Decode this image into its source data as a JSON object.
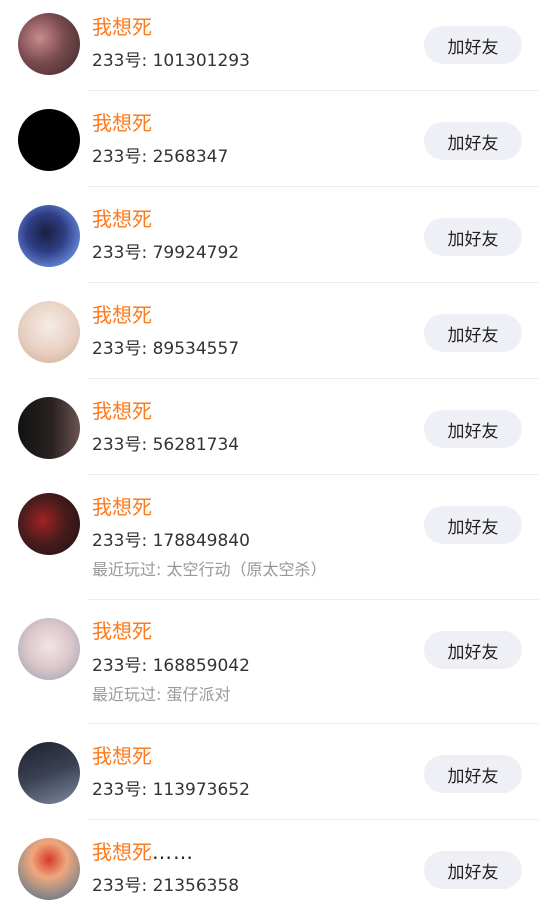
{
  "contacts": [
    {
      "name": "我想死",
      "id_prefix": "233号: ",
      "id": "101301293",
      "recent": "",
      "button": "加好友",
      "avatar_colors": [
        "#5a3a3f",
        "#c98b8b"
      ]
    },
    {
      "name": "我想死",
      "id_prefix": "233号: ",
      "id": "2568347",
      "recent": "",
      "button": "加好友",
      "avatar_colors": [
        "#000000",
        "#000000"
      ]
    },
    {
      "name": "我想死",
      "id_prefix": "233号: ",
      "id": "79924792",
      "recent": "",
      "button": "加好友",
      "avatar_colors": [
        "#2f3e86",
        "#6d8fe0"
      ]
    },
    {
      "name": "我想死",
      "id_prefix": "233号: ",
      "id": "89534557",
      "recent": "",
      "button": "加好友",
      "avatar_colors": [
        "#f3e6df",
        "#d9b9a5"
      ]
    },
    {
      "name": "我想死",
      "id_prefix": "233号: ",
      "id": "56281734",
      "recent": "",
      "button": "加好友",
      "avatar_colors": [
        "#1b1b1b",
        "#6a5450"
      ]
    },
    {
      "name": "我想死",
      "id_prefix": "233号: ",
      "id": "178849840",
      "recent": "最近玩过: 太空行动（原太空杀）",
      "button": "加好友",
      "avatar_colors": [
        "#2a1818",
        "#a02222"
      ]
    },
    {
      "name": "我想死",
      "id_prefix": "233号: ",
      "id": "168859042",
      "recent": "最近玩过: 蛋仔派对",
      "button": "加好友",
      "avatar_colors": [
        "#e8d6d8",
        "#8f9ab0"
      ]
    },
    {
      "name": "我想死",
      "id_prefix": "233号: ",
      "id": "113973652",
      "recent": "",
      "button": "加好友",
      "avatar_colors": [
        "#2b2f3c",
        "#717a92"
      ]
    },
    {
      "name": "我想死",
      "name_suffix": "……",
      "id_prefix": "233号: ",
      "id": "21356358",
      "recent": "",
      "button": "加好友",
      "avatar_colors": [
        "#f0a77e",
        "#3d6f8c"
      ]
    }
  ]
}
